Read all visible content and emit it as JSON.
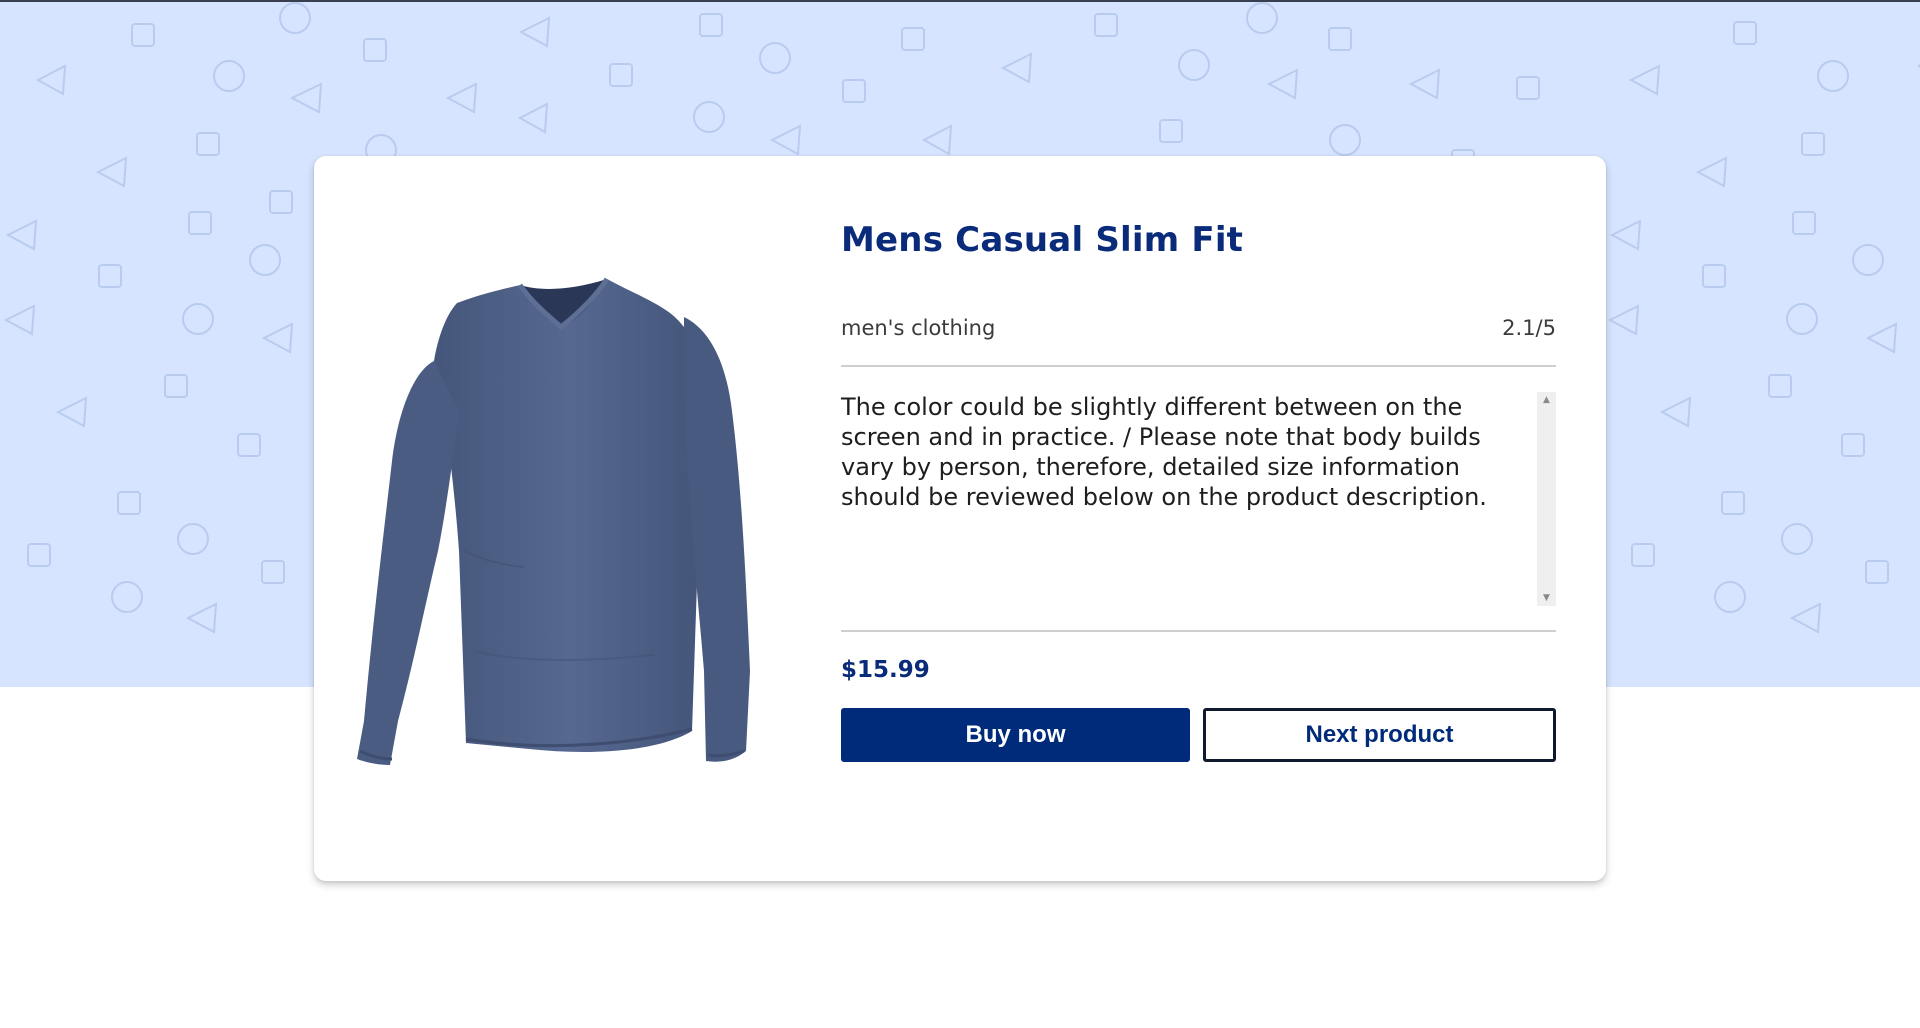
{
  "product": {
    "title": "Mens Casual Slim Fit",
    "category": "men's clothing",
    "rating": "2.1/5",
    "description": "The color could be slightly different between on the screen and in practice. / Please note that body builds vary by person, therefore, detailed size information should be reviewed below on the product description.",
    "price": "$15.99",
    "image_icon": "long-sleeve-v-neck-shirt"
  },
  "actions": {
    "buy_label": "Buy now",
    "next_label": "Next product"
  },
  "colors": {
    "accent": "#002a7a",
    "hero_background": "#d6e4ff",
    "shirt": "#4f6187"
  }
}
